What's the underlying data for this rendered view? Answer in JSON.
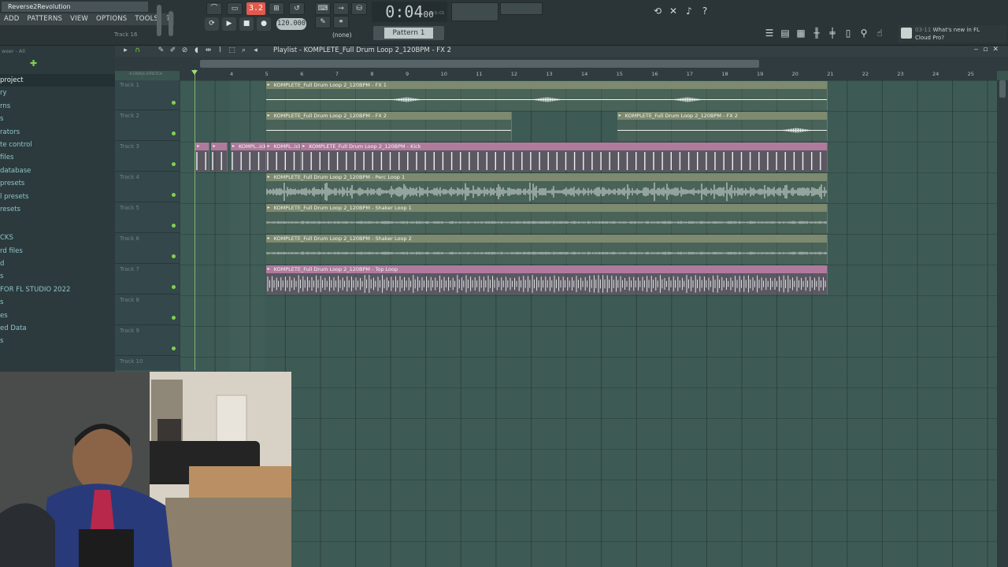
{
  "app": {
    "project_name": "Reverse2Revolution",
    "menu": [
      "ADD",
      "PATTERNS",
      "VIEW",
      "OPTIONS",
      "TOOLS",
      "?"
    ],
    "hint_track": "Track 16",
    "pattern_mode_label": "3.2",
    "tempo": "120.000",
    "pattern_none": "(none)",
    "pattern_name": "Pattern 1",
    "time_main": "0:04",
    "time_sub": "00",
    "time_unit": "M:S:CS",
    "news_date": "03-11",
    "news_text_1": "What's new in FL",
    "news_text_2": "Cloud Pro?"
  },
  "browser": {
    "filter": "wser - All",
    "items": [
      {
        "label": "project",
        "style": "cur"
      },
      {
        "label": "ry",
        "style": "sub"
      },
      {
        "label": "rns",
        "style": "sub"
      },
      {
        "label": "s",
        "style": "sub"
      },
      {
        "label": "rators",
        "style": "sub"
      },
      {
        "label": "te control",
        "style": "sub"
      },
      {
        "label": "files",
        "style": "sub"
      },
      {
        "label": "database",
        "style": "sub"
      },
      {
        "label": "presets",
        "style": "sub"
      },
      {
        "label": "l presets",
        "style": "sub"
      },
      {
        "label": "resets",
        "style": "sub"
      },
      {
        "label": "",
        "style": "gap"
      },
      {
        "label": "CKS",
        "style": "sub"
      },
      {
        "label": "rd files",
        "style": "sub"
      },
      {
        "label": "d",
        "style": "sub"
      },
      {
        "label": "s",
        "style": "sub"
      },
      {
        "label": "FOR FL STUDIO 2022",
        "style": "sub"
      },
      {
        "label": "s",
        "style": "sub"
      },
      {
        "label": "es",
        "style": "sub"
      },
      {
        "label": "ed Data",
        "style": "sub"
      },
      {
        "label": "s",
        "style": "sub"
      }
    ]
  },
  "playlist": {
    "title": "Playlist - KOMPLETE_Full Drum Loop 2_120BPM - FX 2",
    "ruler": [
      "4",
      "5",
      "6",
      "7",
      "8",
      "9",
      "10",
      "11",
      "12",
      "13",
      "14",
      "15",
      "16",
      "17",
      "18",
      "19",
      "20",
      "21",
      "22",
      "23",
      "24",
      "25"
    ],
    "xfade_label": "X-CROSS STRETCH",
    "tracks": [
      "Track 1",
      "Track 2",
      "Track 3",
      "Track 4",
      "Track 5",
      "Track 6",
      "Track 7",
      "Track 8",
      "Track 9",
      "Track 10"
    ],
    "clips": [
      {
        "track": 0,
        "bar_start": 5,
        "bar_end": 21,
        "color": "g",
        "label": "KOMPLETE_Full Drum Loop 2_120BPM - FX 1",
        "wave": "fx1"
      },
      {
        "track": 1,
        "bar_start": 5,
        "bar_end": 12,
        "color": "g",
        "label": "KOMPLETE_Full Drum Loop 2_120BPM - FX 2",
        "wave": "fx2"
      },
      {
        "track": 1,
        "bar_start": 15,
        "bar_end": 21,
        "color": "g",
        "label": "KOMPLETE_Full Drum Loop 2_120BPM - FX 2",
        "wave": "fx2b"
      },
      {
        "track": 2,
        "bar_start": 3.0,
        "bar_end": 3.4,
        "color": "p",
        "label": "",
        "wave": "kick"
      },
      {
        "track": 2,
        "bar_start": 3.45,
        "bar_end": 3.9,
        "color": "p",
        "label": "",
        "wave": "kick"
      },
      {
        "track": 2,
        "bar_start": 4.0,
        "bar_end": 5.0,
        "color": "p",
        "label": "KOMPL..ick",
        "wave": "kick"
      },
      {
        "track": 2,
        "bar_start": 5.0,
        "bar_end": 6.0,
        "color": "p",
        "label": "KOMPL..ick",
        "wave": "kick"
      },
      {
        "track": 2,
        "bar_start": 6.0,
        "bar_end": 21,
        "color": "p",
        "label": "KOMPLETE_Full Drum Loop 2_120BPM - Kick",
        "wave": "kick"
      },
      {
        "track": 3,
        "bar_start": 5,
        "bar_end": 21,
        "color": "g",
        "label": "KOMPLETE_Full Drum Loop 2_120BPM - Perc Loop 1",
        "wave": "perc"
      },
      {
        "track": 4,
        "bar_start": 5,
        "bar_end": 21,
        "color": "g",
        "label": "KOMPLETE_Full Drum Loop 2_120BPM - Shaker Loop 1",
        "wave": "shaker"
      },
      {
        "track": 5,
        "bar_start": 5,
        "bar_end": 21,
        "color": "g",
        "label": "KOMPLETE_Full Drum Loop 2_120BPM - Shaker Loop 2",
        "wave": "shaker"
      },
      {
        "track": 6,
        "bar_start": 5,
        "bar_end": 21,
        "color": "p",
        "label": "KOMPLETE_Full Drum Loop 2_120BPM - Top Loop",
        "wave": "top"
      }
    ]
  }
}
